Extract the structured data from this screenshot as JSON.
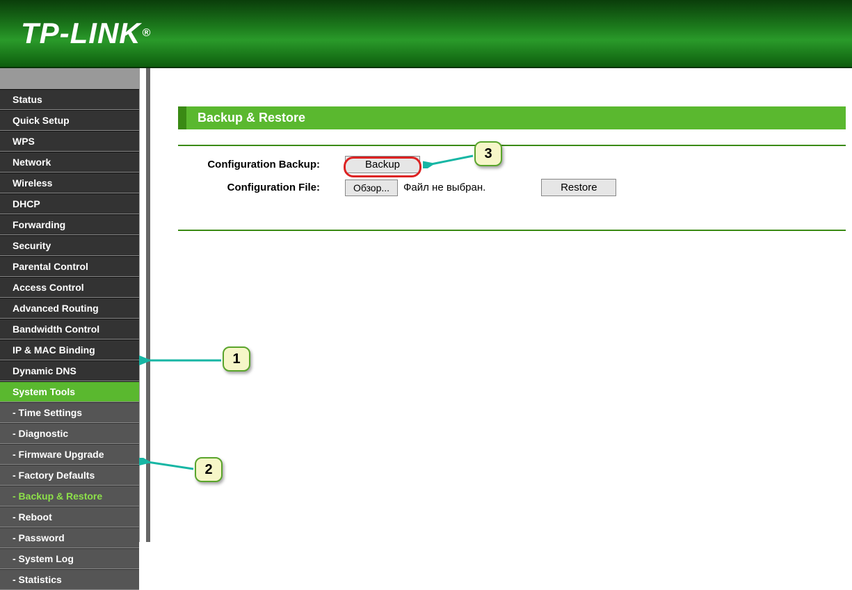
{
  "brand": "TP-LINK",
  "sidebar": {
    "items": [
      {
        "label": "Status"
      },
      {
        "label": "Quick Setup"
      },
      {
        "label": "WPS"
      },
      {
        "label": "Network"
      },
      {
        "label": "Wireless"
      },
      {
        "label": "DHCP"
      },
      {
        "label": "Forwarding"
      },
      {
        "label": "Security"
      },
      {
        "label": "Parental Control"
      },
      {
        "label": "Access Control"
      },
      {
        "label": "Advanced Routing"
      },
      {
        "label": "Bandwidth Control"
      },
      {
        "label": "IP & MAC Binding"
      },
      {
        "label": "Dynamic DNS"
      },
      {
        "label": "System Tools"
      }
    ],
    "subitems": [
      {
        "label": "- Time Settings"
      },
      {
        "label": "- Diagnostic"
      },
      {
        "label": "- Firmware Upgrade"
      },
      {
        "label": "- Factory Defaults"
      },
      {
        "label": "- Backup & Restore"
      },
      {
        "label": "- Reboot"
      },
      {
        "label": "- Password"
      },
      {
        "label": "- System Log"
      },
      {
        "label": "- Statistics"
      }
    ]
  },
  "panel": {
    "title": "Backup & Restore",
    "row1_label": "Configuration Backup:",
    "row2_label": "Configuration File:",
    "backup_btn": "Backup",
    "browse_btn": "Обзор...",
    "file_status": "Файл не выбран.",
    "restore_btn": "Restore"
  },
  "callouts": {
    "c1": "1",
    "c2": "2",
    "c3": "3"
  }
}
